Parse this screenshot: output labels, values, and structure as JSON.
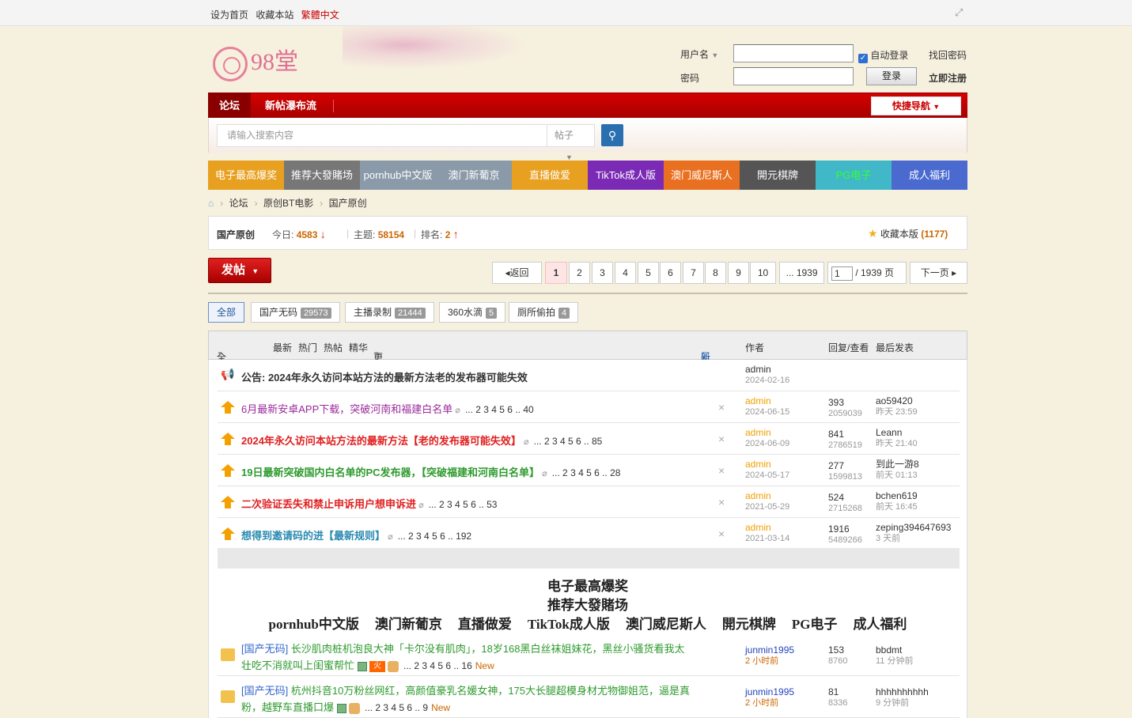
{
  "topbar": {
    "set_home": "设为首页",
    "bookmark": "收藏本站",
    "traditional": "繁體中文"
  },
  "header": {
    "logo_text": "98堂",
    "username_label": "用户名",
    "password_label": "密码",
    "autologin": "自动登录",
    "forgot": "找回密码",
    "login": "登录",
    "register": "立即注册"
  },
  "nav": {
    "forum": "论坛",
    "waterfall": "新帖瀑布流",
    "quicknav": "快捷导航"
  },
  "search": {
    "placeholder": "请输入搜索内容",
    "type": "帖子"
  },
  "banners": [
    {
      "label": "电子最高爆奖",
      "color": "#e8a020"
    },
    {
      "label": "推荐大發賭场",
      "color": "#777777"
    },
    {
      "label": "pornhub中文版",
      "color": "#8a9aa8"
    },
    {
      "label": "澳门新葡京",
      "color": "#8a9aa8"
    },
    {
      "label": "直播做爱",
      "color": "#e8a020"
    },
    {
      "label": "TikTok成人版",
      "color": "#7b2ab5"
    },
    {
      "label": "澳门威尼斯人",
      "color": "#e87020"
    },
    {
      "label": "開元棋牌",
      "color": "#555555"
    },
    {
      "label": "PG电子",
      "color": "#40b8c8"
    },
    {
      "label": "成人福利",
      "color": "#4a6ad0"
    }
  ],
  "breadcrumb": [
    "论坛",
    "原创BT电影",
    "国产原创"
  ],
  "forum": {
    "name": "国产原创",
    "today_label": "今日:",
    "today": "4583",
    "topics_label": "主题:",
    "topics": "58154",
    "rank_label": "排名:",
    "rank": "2",
    "fav_label": "收藏本版",
    "fav_count": "(1177)"
  },
  "post_button": "发帖",
  "pagination": {
    "back": "返回",
    "pages": [
      "1",
      "2",
      "3",
      "4",
      "5",
      "6",
      "7",
      "8",
      "9",
      "10",
      "... 1939"
    ],
    "current": "1",
    "total": "/ 1939 页",
    "next": "下一页"
  },
  "tabs": [
    {
      "label": "全部",
      "count": ""
    },
    {
      "label": "国产无码",
      "count": "29573"
    },
    {
      "label": "主播录制",
      "count": "21444"
    },
    {
      "label": "360水滴",
      "count": "5"
    },
    {
      "label": "厕所偷拍",
      "count": "4"
    }
  ],
  "thead": {
    "all": "全部主题",
    "latest": "最新",
    "hot": "热门",
    "hotpost": "热帖",
    "digest": "精华",
    "more": "更多",
    "newwin": "新窗",
    "author": "作者",
    "reply_view": "回复/查看",
    "last_post": "最后发表"
  },
  "announcement": {
    "title": "公告: 2024年永久访问本站方法的最新方法老的发布器可能失效",
    "author": "admin",
    "date": "2024-02-16"
  },
  "sticky": [
    {
      "title": "6月最新安卓APP下载，突破河南和福建白名单",
      "color": "#9b2a9b",
      "pages": "... 2 3 4 5 6 .. 40",
      "author": "admin",
      "date": "2024-06-15",
      "replies": "393",
      "views": "2059039",
      "last_user": "ao59420",
      "last_time": "昨天 23:59"
    },
    {
      "title": "2024年永久访问本站方法的最新方法【老的发布器可能失效】",
      "color": "#e02020",
      "pages": "... 2 3 4 5 6 .. 85",
      "author": "admin",
      "date": "2024-06-09",
      "replies": "841",
      "views": "2786519",
      "last_user": "Leann",
      "last_time": "昨天 21:40"
    },
    {
      "title": "19日最新突破国内白名单的PC发布器，【突破福建和河南白名单】",
      "color": "#2e9a2e",
      "pages": "... 2 3 4 5 6 .. 28",
      "author": "admin",
      "date": "2024-05-17",
      "replies": "277",
      "views": "1599813",
      "last_user": "到此一游8",
      "last_time": "前天 01:13"
    },
    {
      "title": "二次验证丢失和禁止申诉用户想申诉进",
      "color": "#e02020",
      "pages": "... 2 3 4 5 6 .. 53",
      "author": "admin",
      "date": "2021-05-29",
      "replies": "524",
      "views": "2715268",
      "last_user": "bchen619",
      "last_time": "前天 16:45"
    },
    {
      "title": "想得到邀请码的进【最新规则】",
      "color": "#2a8ab0",
      "pages": "... 2 3 4 5 6 .. 192",
      "author": "admin",
      "date": "2021-03-14",
      "replies": "1916",
      "views": "5489266",
      "last_user": "zeping394647693",
      "last_time": "3 天前"
    }
  ],
  "ads": {
    "line1": "电子最高爆奖",
    "line2": "推荐大發賭场",
    "line3": [
      "pornhub中文版",
      "澳门新葡京",
      "直播做爱",
      "TikTok成人版",
      "澳门威尼斯人",
      "開元棋牌",
      "PG电子",
      "成人福利"
    ]
  },
  "threads": [
    {
      "cat": "[国产无码]",
      "title1": "长沙肌肉桩机泡良大神「卡尔没有肌肉」，18岁168黑白丝袜姐妹花，黑丝小骚货看我太",
      "title2": "壮吃不消就叫上闺蜜帮忙",
      "pages": "... 2 3 4 5 6 .. 16",
      "new": "New",
      "author": "junmin1995",
      "time": "2 小时前",
      "replies": "153",
      "views": "8760",
      "last_user": "bbdmt",
      "last_time": "11 分钟前"
    },
    {
      "cat": "[国产无码]",
      "title1": "杭州抖音10万粉丝网红，高颜值豪乳名媛女神，175大长腿超模身材尤物御姐范，逼是真",
      "title2": "粉，越野车直播口爆",
      "pages": "... 2 3 4 5 6 .. 9",
      "new": "New",
      "author": "junmin1995",
      "time": "2 小时前",
      "replies": "81",
      "views": "8336",
      "last_user": "hhhhhhhhhh",
      "last_time": "9 分钟前"
    }
  ]
}
